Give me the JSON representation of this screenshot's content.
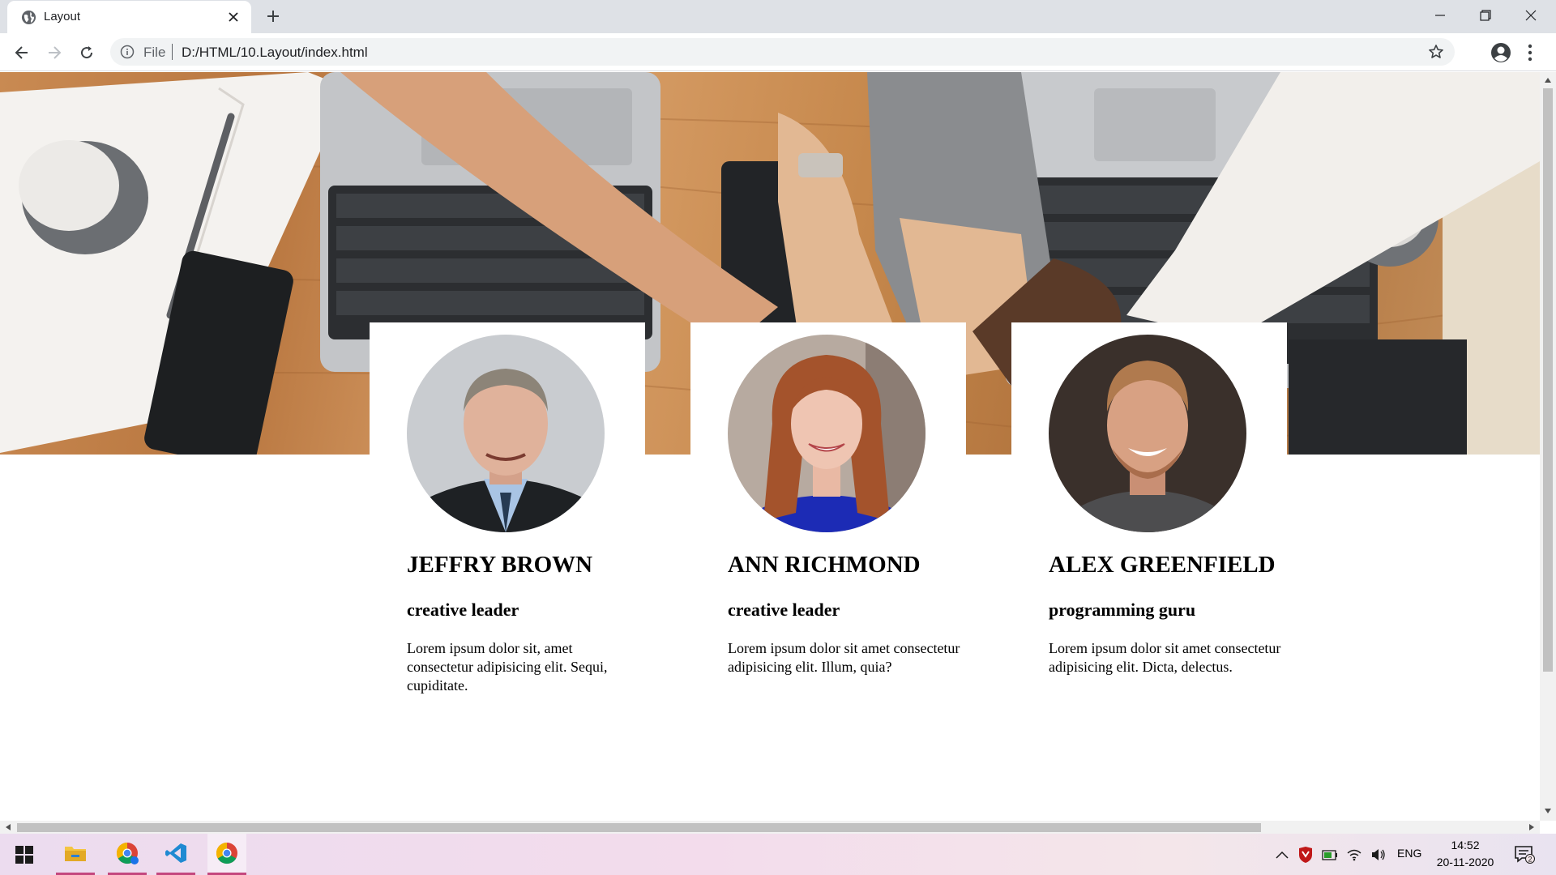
{
  "browser": {
    "tab_title": "Layout",
    "omnibox_scheme": "File",
    "url": "D:/HTML/10.Layout/index.html"
  },
  "team": [
    {
      "name": "JEFFRY BROWN",
      "role": "creative leader",
      "text": "Lorem ipsum dolor sit, amet consectetur adipisicing elit. Sequi, cupiditate."
    },
    {
      "name": "ANN RICHMOND",
      "role": "creative leader",
      "text": "Lorem ipsum dolor sit amet consectetur adipisicing elit. Illum, quia?"
    },
    {
      "name": "ALEX GREENFIELD",
      "role": "programming guru",
      "text": "Lorem ipsum dolor sit amet consectetur adipisicing elit. Dicta, delectus."
    }
  ],
  "taskbar": {
    "language": "ENG",
    "time": "14:52",
    "date": "20-11-2020",
    "notification_count": "2"
  },
  "colors": {
    "tabbar_bg": "#dee1e6",
    "taskbar_accent": "#c4477e",
    "chrome_blue": "#1a73e8"
  }
}
